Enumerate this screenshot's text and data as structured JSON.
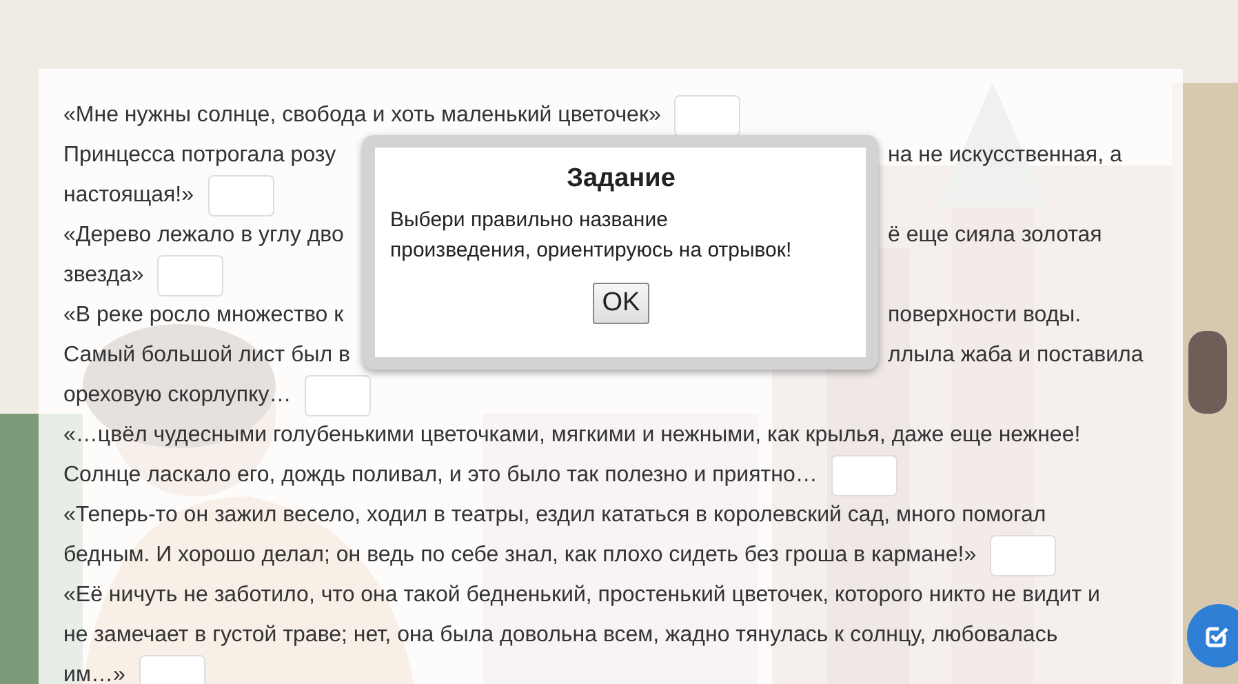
{
  "lines": [
    {
      "text": "«Мне нужны солнце, свобода и хоть маленький цветочек»",
      "answer_box": true
    },
    {
      "left": "Принцесса потрогала розу",
      "right": "на не искусственная, а",
      "answer_box": false
    },
    {
      "text": "настоящая!»",
      "answer_box": true
    },
    {
      "left": "«Дерево лежало в углу дво",
      "right": "ё еще сияла золотая",
      "answer_box": false
    },
    {
      "text": "звезда»",
      "answer_box": true
    },
    {
      "left": "«В реке росло множество к",
      "right": "поверхности воды.",
      "answer_box": false
    },
    {
      "left": "Самый большой лист был в",
      "right": "ллыла жаба и поставила",
      "answer_box": false
    },
    {
      "text": "ореховую скорлупку…",
      "answer_box": true
    },
    {
      "text": "«…цвёл чудесными голубенькими цветочками, мягкими и нежными, как крылья, даже еще нежнее!",
      "answer_box": false
    },
    {
      "text": "Солнце ласкало его, дождь поливал, и это было так полезно и приятно…",
      "answer_box": true
    },
    {
      "text": "«Теперь-то он зажил весело, ходил в театры, ездил кататься в королевский сад, много помогал",
      "answer_box": false
    },
    {
      "text": "бедным. И хорошо делал; он ведь по себе знал, как плохо сидеть без гроша в кармане!»",
      "answer_box": true
    },
    {
      "text": "«Её ничуть не заботило, что она такой бедненький, простенький цветочек, которого никто не видит и",
      "answer_box": false
    },
    {
      "text": "не замечает в густой траве; нет, она была довольна всем, жадно тянулась к солнцу, любовалась",
      "answer_box": false
    },
    {
      "text": "им…»",
      "answer_box": true
    }
  ],
  "dialog": {
    "title": "Задание",
    "message": "Выбери правильно название произведения, ориентируюсь на отрывок!",
    "button": "OK"
  }
}
